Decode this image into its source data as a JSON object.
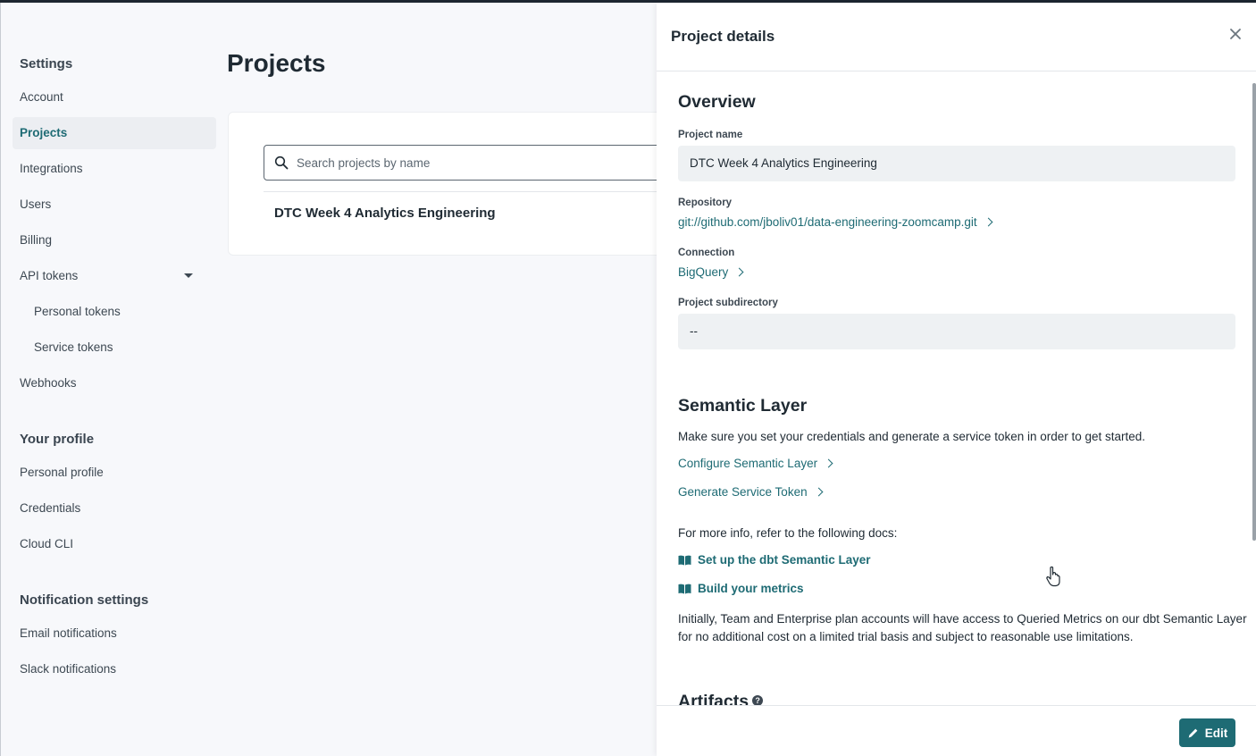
{
  "sidebar": {
    "settings_heading": "Settings",
    "settings_items": [
      {
        "label": "Account"
      },
      {
        "label": "Projects"
      },
      {
        "label": "Integrations"
      },
      {
        "label": "Users"
      },
      {
        "label": "Billing"
      },
      {
        "label": "API tokens"
      },
      {
        "label": "Personal tokens"
      },
      {
        "label": "Service tokens"
      },
      {
        "label": "Webhooks"
      }
    ],
    "profile_heading": "Your profile",
    "profile_items": [
      {
        "label": "Personal profile"
      },
      {
        "label": "Credentials"
      },
      {
        "label": "Cloud CLI"
      }
    ],
    "notification_heading": "Notification settings",
    "notification_items": [
      {
        "label": "Email notifications"
      },
      {
        "label": "Slack notifications"
      }
    ]
  },
  "main": {
    "title": "Projects",
    "search": {
      "placeholder": "Search projects by name",
      "value": ""
    },
    "projects": [
      {
        "name": "DTC Week 4 Analytics Engineering"
      }
    ]
  },
  "panel": {
    "title": "Project details",
    "overview": {
      "title": "Overview",
      "project_name_label": "Project name",
      "project_name_value": "DTC Week 4 Analytics Engineering",
      "repository_label": "Repository",
      "repository_value": "git://github.com/jboliv01/data-engineering-zoomcamp.git",
      "connection_label": "Connection",
      "connection_value": "BigQuery",
      "subdirectory_label": "Project subdirectory",
      "subdirectory_value": "--"
    },
    "semantic_layer": {
      "title": "Semantic Layer",
      "intro": "Make sure you set your credentials and generate a service token in order to get started.",
      "configure_link": "Configure Semantic Layer",
      "generate_link": "Generate Service Token",
      "docs_intro": "For more info, refer to the following docs:",
      "doc_links": [
        {
          "label": "Set up the dbt Semantic Layer"
        },
        {
          "label": "Build your metrics"
        }
      ],
      "note_line1": "Initially, Team and Enterprise plan accounts will have access to Queried Metrics on our dbt Semantic Layer",
      "note_line2": "for no additional cost on a limited trial basis and subject to reasonable use limitations."
    },
    "artifacts_title": "Artifacts",
    "edit_label": "Edit"
  },
  "colors": {
    "accent": "#1e6b74",
    "active_bg": "#eceef2",
    "field_bg": "#eef1f3",
    "page_bg": "#f7f8fb"
  }
}
